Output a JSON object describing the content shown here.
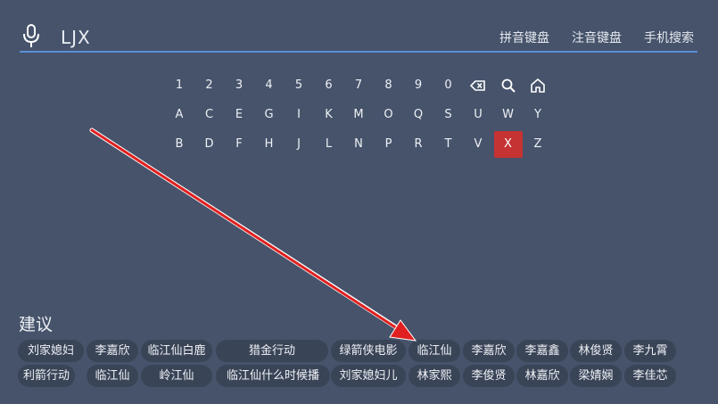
{
  "search": {
    "query": "LJX",
    "modes": [
      "拼音键盘",
      "注音键盘",
      "手机搜索"
    ]
  },
  "keyboard": {
    "rows": [
      [
        "1",
        "2",
        "3",
        "4",
        "5",
        "6",
        "7",
        "8",
        "9",
        "0",
        "backspace-icon",
        "search-icon",
        "home-icon"
      ],
      [
        "A",
        "C",
        "E",
        "G",
        "I",
        "K",
        "M",
        "O",
        "Q",
        "S",
        "U",
        "W",
        "Y"
      ],
      [
        "B",
        "D",
        "F",
        "H",
        "J",
        "L",
        "N",
        "P",
        "R",
        "T",
        "V",
        "X",
        "Z"
      ]
    ],
    "selected_key": "X"
  },
  "suggestions": {
    "title": "建议",
    "rows": [
      [
        "刘家媳妇",
        "李嘉欣",
        "临江仙白鹿",
        "猎金行动",
        "绿箭侠电影",
        "临江仙",
        "李嘉欣",
        "李嘉鑫",
        "林俊贤",
        "李九霄"
      ],
      [
        "利箭行动",
        "临江仙",
        "岭江仙",
        "临江仙什么时候播",
        "刘家媳妇儿",
        "林家熙",
        "李俊贤",
        "林嘉欣",
        "梁婧娴",
        "李佳芯"
      ]
    ]
  },
  "colors": {
    "background": "#46536b",
    "chip": "#3a4457",
    "selected_key": "#c53333",
    "underline": "#5a8fd6",
    "annotation_arrow": "#e02020"
  }
}
